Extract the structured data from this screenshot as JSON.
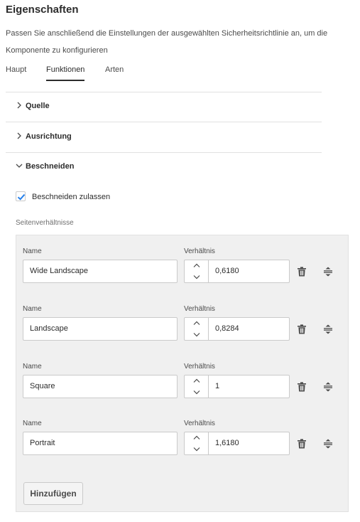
{
  "title": "Eigenschaften",
  "description": "Passen Sie anschließend die Einstellungen der ausgewählten Sicherheitsrichtlinie an, um die Komponente zu konfigurieren",
  "tabs": [
    {
      "label": "Haupt",
      "active": false
    },
    {
      "label": "Funktionen",
      "active": true
    },
    {
      "label": "Arten",
      "active": false
    }
  ],
  "sections": [
    {
      "label": "Quelle",
      "expanded": false
    },
    {
      "label": "Ausrichtung",
      "expanded": false
    },
    {
      "label": "Beschneiden",
      "expanded": true
    }
  ],
  "crop": {
    "allow_label": "Beschneiden zulassen",
    "allow_checked": true,
    "aspect_label": "Seitenverhältnisse",
    "name_label": "Name",
    "ratio_label": "Verhältnis",
    "ratios": [
      {
        "name": "Wide Landscape",
        "ratio": "0,6180"
      },
      {
        "name": "Landscape",
        "ratio": "0,8284"
      },
      {
        "name": "Square",
        "ratio": "1"
      },
      {
        "name": "Portrait",
        "ratio": "1,6180"
      }
    ],
    "add_label": "Hinzufügen"
  },
  "icons": {
    "chevron": "chevron-right-icon",
    "chevron_expanded": "chevron-down-icon",
    "checkbox": "checkmark-icon",
    "step_up": "chevron-up-icon",
    "step_down": "chevron-down-icon",
    "delete": "trash-icon",
    "reorder": "drag-handle-icon"
  },
  "colors": {
    "accent": "#2680eb",
    "panel_bg": "#f0f0f0",
    "text": "#2c2c2c"
  }
}
